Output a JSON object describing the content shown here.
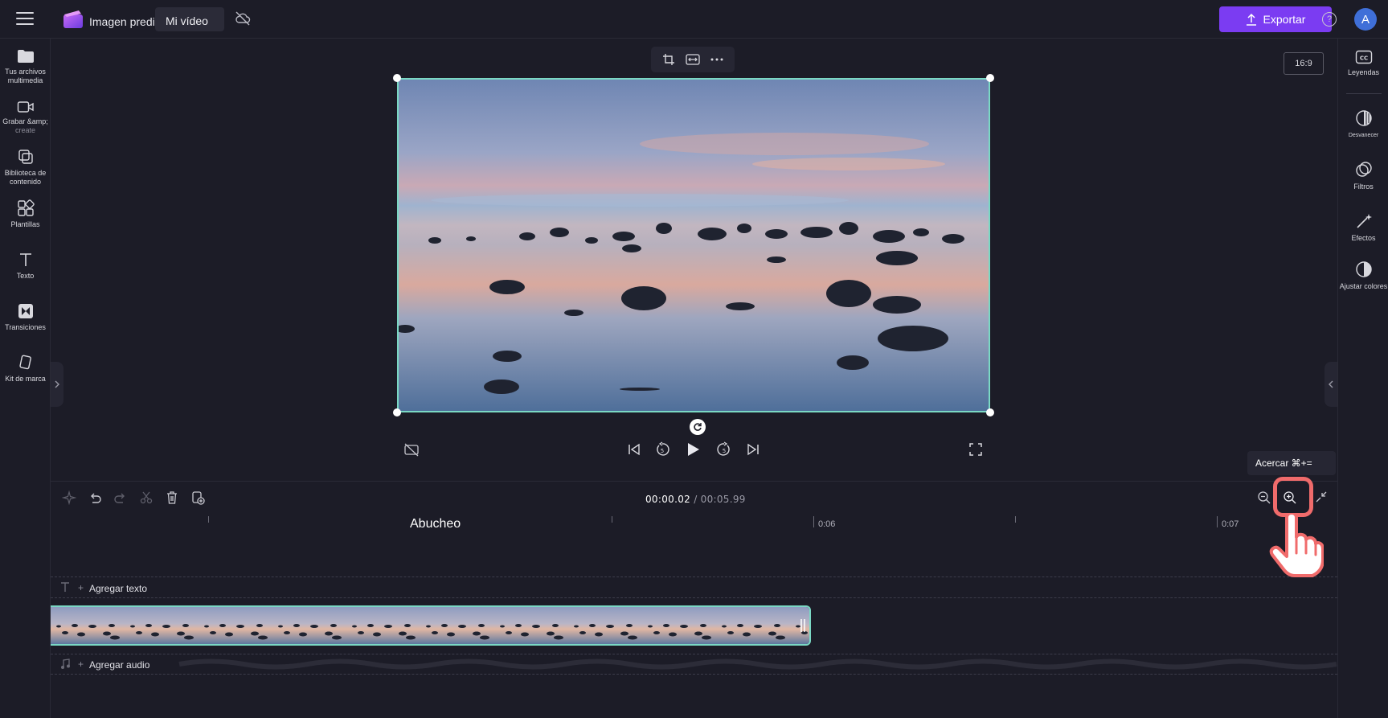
{
  "app": {
    "title": "Imagen prediseñada",
    "project_title": "Mi vídeo",
    "export_label": "Exportar",
    "help_label": "?",
    "avatar_initial": "A",
    "accent_color": "#7b3cf2",
    "selection_color": "#7ad8c4"
  },
  "left_sidebar": {
    "items": [
      {
        "label": "Tus archivos multimedia",
        "icon": "folder-icon"
      },
      {
        "label": "Grabar &amp;",
        "sub": "create",
        "icon": "camera-icon"
      },
      {
        "label": "Biblioteca de contenido",
        "icon": "library-icon"
      },
      {
        "label": "Plantillas",
        "icon": "templates-icon"
      },
      {
        "label": "Texto",
        "icon": "text-icon"
      },
      {
        "label": "Transiciones",
        "icon": "transitions-icon"
      },
      {
        "label": "Kit de marca",
        "icon": "brand-kit-icon"
      }
    ]
  },
  "right_sidebar": {
    "items": [
      {
        "label": "Leyendas",
        "icon": "captions-icon"
      },
      {
        "label": "Desvanecer",
        "icon": "fade-icon"
      },
      {
        "label": "Filtros",
        "icon": "filters-icon"
      },
      {
        "label": "Efectos",
        "icon": "effects-icon"
      },
      {
        "label": "Ajustar colores",
        "icon": "adjust-colors-icon"
      }
    ]
  },
  "preview": {
    "aspect_ratio": "16:9",
    "toolbar": [
      "crop-icon",
      "fit-icon",
      "more-icon"
    ]
  },
  "timeline": {
    "current_time": "00:00.02",
    "separator": " / ",
    "total_time": "00:05.99",
    "clip_name": "Abucheo",
    "ruler_labels": [
      "0:06",
      "0:07"
    ],
    "add_text_label": "Agregar texto",
    "add_audio_label": "Agregar audio",
    "zoom_tooltip": "Acercar ⌘+="
  }
}
